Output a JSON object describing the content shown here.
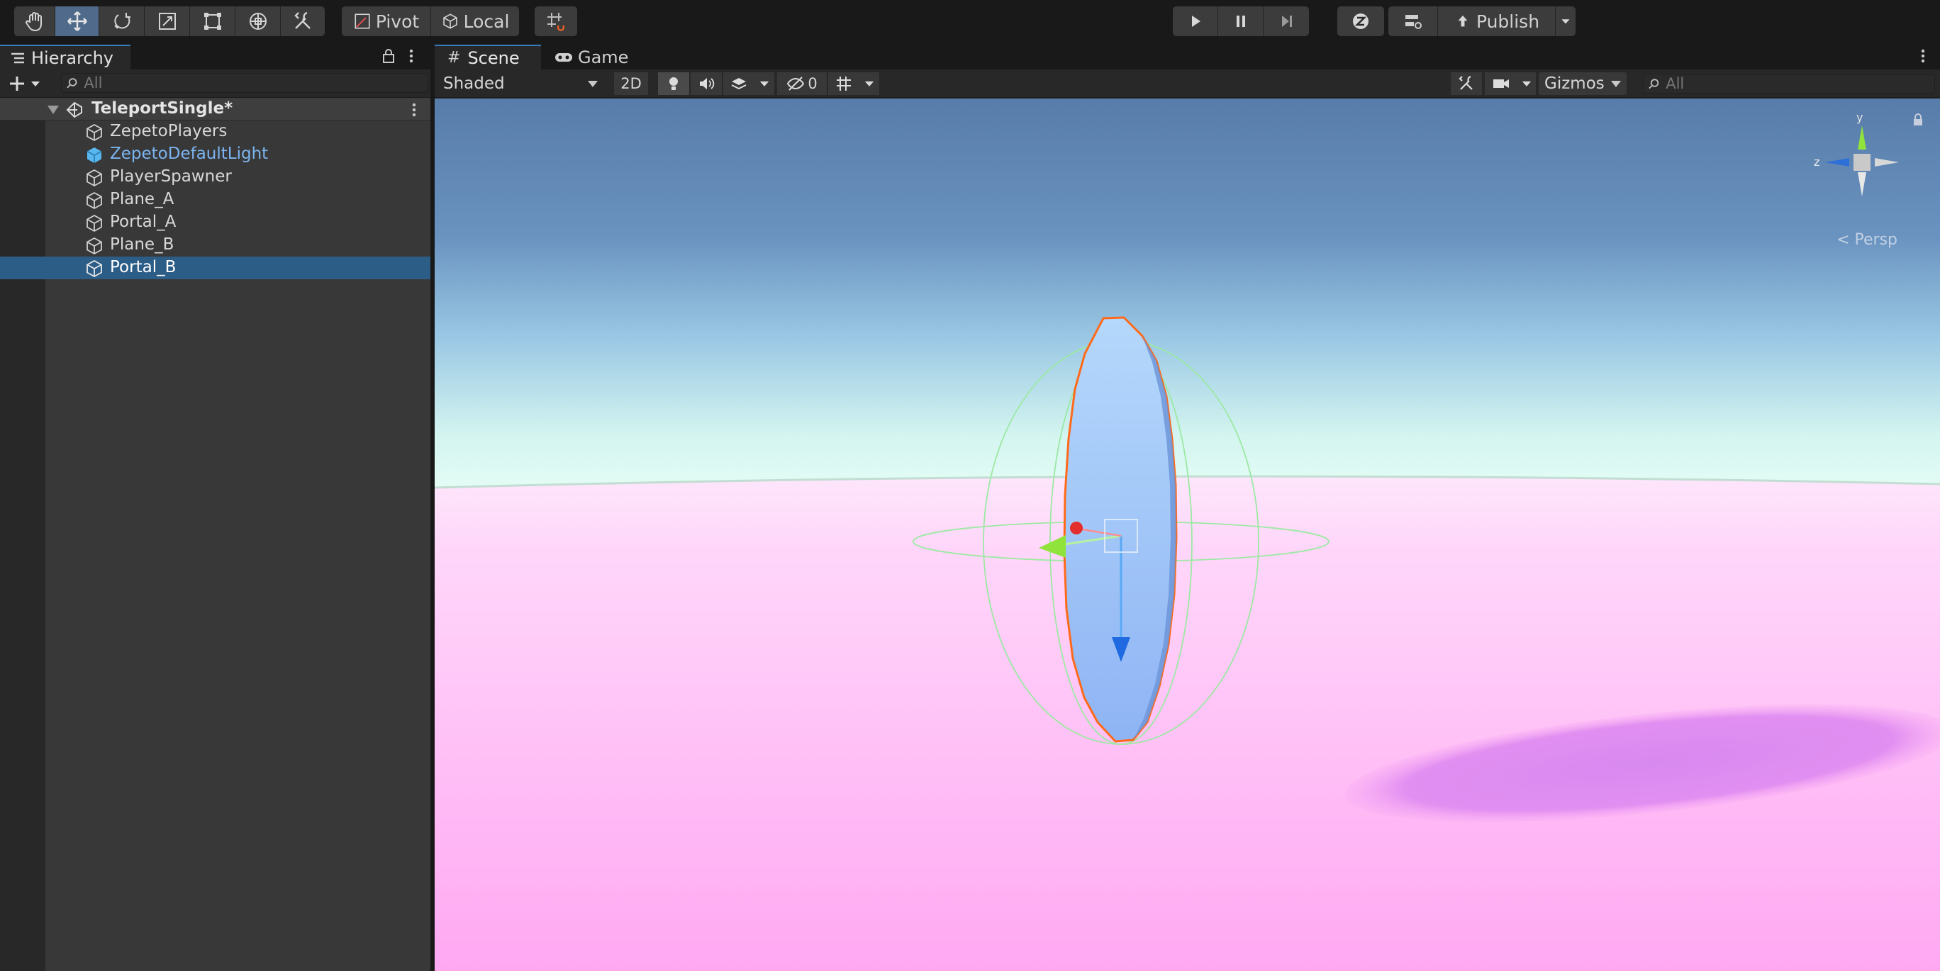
{
  "toolbar": {
    "tools": [
      "hand-tool",
      "move-tool",
      "rotate-tool",
      "scale-tool",
      "rect-tool",
      "transform-tool",
      "custom-tool"
    ],
    "active_tool": "move-tool",
    "pivot_label": "Pivot",
    "local_label": "Local",
    "publish_label": "Publish"
  },
  "hierarchy": {
    "tab_label": "Hierarchy",
    "search_placeholder": "All",
    "scene_name": "TeleportSingle*",
    "items": [
      {
        "label": "ZepetoPlayers",
        "icon": "gameobject-icon",
        "prefab": false,
        "selected": false
      },
      {
        "label": "ZepetoDefaultLight",
        "icon": "prefab-icon",
        "prefab": true,
        "selected": false
      },
      {
        "label": "PlayerSpawner",
        "icon": "gameobject-icon",
        "prefab": false,
        "selected": false
      },
      {
        "label": "Plane_A",
        "icon": "gameobject-icon",
        "prefab": false,
        "selected": false
      },
      {
        "label": "Portal_A",
        "icon": "gameobject-icon",
        "prefab": false,
        "selected": false
      },
      {
        "label": "Plane_B",
        "icon": "gameobject-icon",
        "prefab": false,
        "selected": false
      },
      {
        "label": "Portal_B",
        "icon": "gameobject-icon",
        "prefab": false,
        "selected": true
      }
    ]
  },
  "scene": {
    "tab_scene": "Scene",
    "tab_game": "Game",
    "draw_mode": "Shaded",
    "mode_2d": "2D",
    "hidden_count": "0",
    "gizmos_label": "Gizmos",
    "search_placeholder": "All",
    "persp_label": "Persp",
    "axis_y": "y",
    "axis_z": "z"
  },
  "colors": {
    "accent": "#3a79bb",
    "selection": "#2c5d87",
    "prefab_text": "#7cb4f0",
    "sky_top": "#5b80ad",
    "ground": "#ffb4f5",
    "portal": "#9ec4f8",
    "outline": "#ff6a1a"
  }
}
